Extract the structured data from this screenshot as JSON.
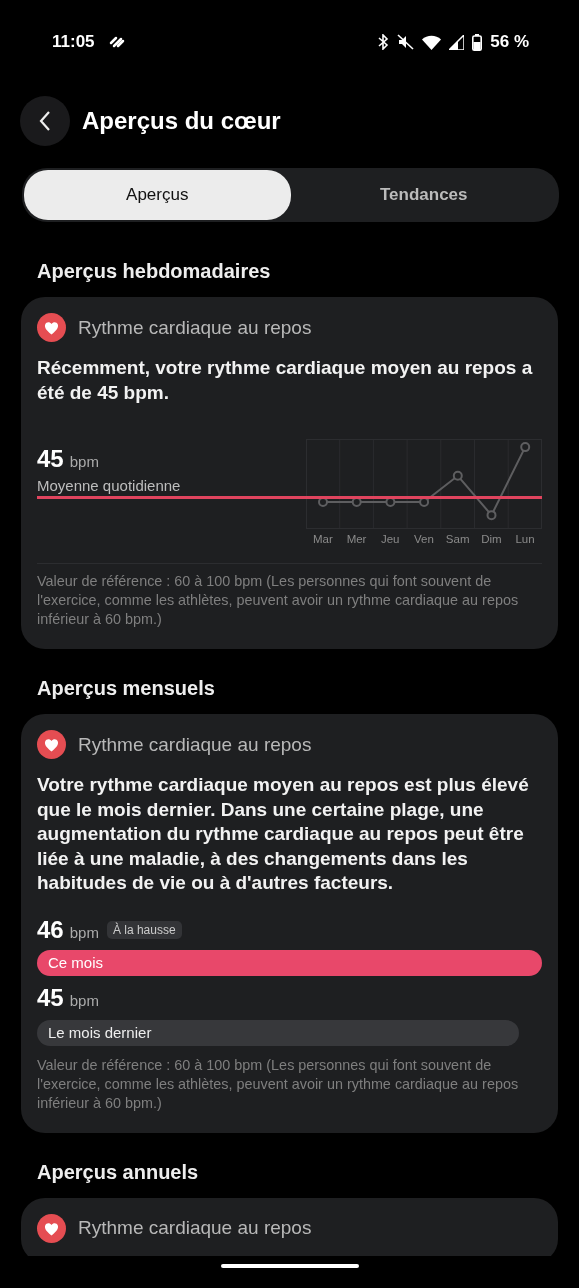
{
  "status_bar": {
    "time": "11:05",
    "battery": "56 %"
  },
  "header": {
    "title": "Aperçus du cœur"
  },
  "tabs": [
    {
      "label": "Aperçus",
      "selected": true
    },
    {
      "label": "Tendances",
      "selected": false
    }
  ],
  "sections": [
    {
      "title": "Aperçus hebdomadaires",
      "card": {
        "kind": "weekly",
        "title": "Rythme cardiaque au repos",
        "summary": "Récemment, votre rythme cardiaque moyen au repos a été de 45 bpm.",
        "value": "45",
        "unit": "bpm",
        "caption": "Moyenne quotidienne",
        "days": [
          "Mar",
          "Mer",
          "Jeu",
          "Ven",
          "Sam",
          "Dim",
          "Lun"
        ],
        "note": "Valeur de référence : 60 à 100 bpm (Les personnes qui font souvent de l'exercice, comme les athlètes, peuvent avoir un rythme cardiaque au repos inférieur à 60 bpm.)"
      }
    },
    {
      "title": "Aperçus mensuels",
      "card": {
        "kind": "monthly",
        "title": "Rythme cardiaque au repos",
        "summary": "Votre rythme cardiaque moyen au repos est plus élevé que le mois dernier. Dans une certaine plage, une augmentation du rythme cardiaque au repos peut être liée à une maladie, à des changements dans les habitudes de vie ou à d'autres facteurs.",
        "bars": [
          {
            "value": "46",
            "unit": "bpm",
            "badge": "À la hausse",
            "label": "Ce mois",
            "current": true
          },
          {
            "value": "45",
            "unit": "bpm",
            "label": "Le mois dernier",
            "current": false
          }
        ],
        "note": "Valeur de référence : 60 à 100 bpm (Les personnes qui font souvent de l'exercice, comme les athlètes, peuvent avoir un rythme cardiaque au repos inférieur à 60 bpm.)"
      }
    },
    {
      "title": "Aperçus annuels",
      "card": {
        "kind": "annual",
        "title": "Rythme cardiaque au repos"
      }
    }
  ]
}
